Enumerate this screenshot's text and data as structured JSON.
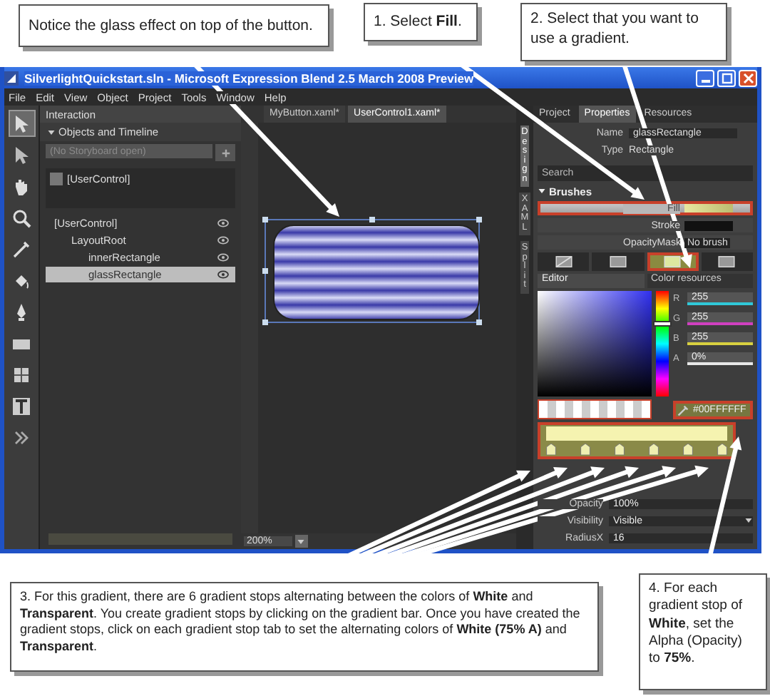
{
  "callouts": [
    {
      "text": "Notice the glass effect on top of the button."
    },
    {
      "text": "1. Select **Fill**."
    },
    {
      "text": "2. Select that you want to use a gradient."
    },
    {
      "text": "3. For this  gradient, there are 6 gradient stops alternating between the colors of **White** and **Transparent**. You create gradient stops by clicking on the gradient bar. Once you have created the gradient stops, click on each gradient stop tab to set the alternating colors of **White (75% A)** and **Transparent**."
    },
    {
      "text": "4. For each gradient stop of **White**, set the Alpha (Opacity) to **75%**."
    }
  ],
  "window": {
    "title": "SilverlightQuickstart.sln - Microsoft Expression Blend 2.5 March 2008 Preview"
  },
  "menu": [
    "File",
    "Edit",
    "View",
    "Object",
    "Project",
    "Tools",
    "Window",
    "Help"
  ],
  "tools": [
    {
      "selected": true
    },
    {
      "selected": false
    },
    {
      "selected": false
    },
    {
      "selected": false
    },
    {
      "selected": false
    },
    {
      "selected": false
    },
    {
      "selected": false
    },
    {
      "selected": false
    },
    {
      "selected": false
    },
    {
      "selected": false
    },
    {
      "selected": false
    }
  ],
  "interaction": {
    "title": "Interaction",
    "section": "Objects and Timeline",
    "storyboard_placeholder": "(No Storyboard open)",
    "scope": "[UserControl]",
    "tree": [
      {
        "label": "[UserControl]",
        "selected": false,
        "children": [
          {
            "label": "LayoutRoot",
            "selected": false,
            "children": [
              {
                "label": "innerRectangle",
                "selected": false
              },
              {
                "label": "glassRectangle",
                "selected": true
              }
            ]
          }
        ]
      }
    ]
  },
  "documents": [
    {
      "label": "MyButton.xaml*",
      "selected": false
    },
    {
      "label": "UserControl1.xaml*",
      "selected": true
    }
  ],
  "view_tabs": [
    {
      "label": "Design",
      "selected": true
    },
    {
      "label": "XAML",
      "selected": false
    },
    {
      "label": "Split",
      "selected": false
    }
  ],
  "zoom": "200%",
  "properties": {
    "tabs": [
      {
        "label": "Project",
        "selected": false
      },
      {
        "label": "Properties",
        "selected": true
      },
      {
        "label": "Resources",
        "selected": false
      }
    ],
    "name_label": "Name",
    "name": "glassRectangle",
    "type_label": "Type",
    "type": "Rectangle",
    "search_placeholder": "Search",
    "brushes_title": "Brushes",
    "brushes": [
      {
        "label": "Fill",
        "kind": "gradient",
        "selected": true
      },
      {
        "label": "Stroke",
        "kind": "solid",
        "selected": false
      },
      {
        "label": "OpacityMask",
        "kind": "none",
        "value": "No brush",
        "selected": false
      }
    ],
    "brush_types": [
      {
        "selected": false
      },
      {
        "selected": false
      },
      {
        "selected": true
      },
      {
        "selected": false
      }
    ],
    "editor_tabs": [
      {
        "label": "Editor",
        "selected": true
      },
      {
        "label": "Color resources",
        "selected": false
      }
    ],
    "channels": [
      {
        "label": "R",
        "value": "255",
        "color": "#30c8d8"
      },
      {
        "label": "G",
        "value": "255",
        "color": "#d040c0"
      },
      {
        "label": "B",
        "value": "255",
        "color": "#d8d040"
      },
      {
        "label": "A",
        "value": "0%",
        "color": "#e8e8e8"
      }
    ],
    "hue": {
      "level": 0.72
    },
    "hex": "#00FFFFFF",
    "gradient_stops": [
      {
        "selected": false
      },
      {
        "selected": false
      },
      {
        "selected": false
      },
      {
        "selected": false
      },
      {
        "selected": false
      },
      {
        "selected": false
      }
    ],
    "appearance": [
      {
        "label": "Opacity",
        "kind": "field",
        "value": "100%"
      },
      {
        "label": "Visibility",
        "kind": "dropdown",
        "value": "Visible"
      },
      {
        "label": "RadiusX",
        "kind": "field",
        "value": "16"
      }
    ]
  }
}
